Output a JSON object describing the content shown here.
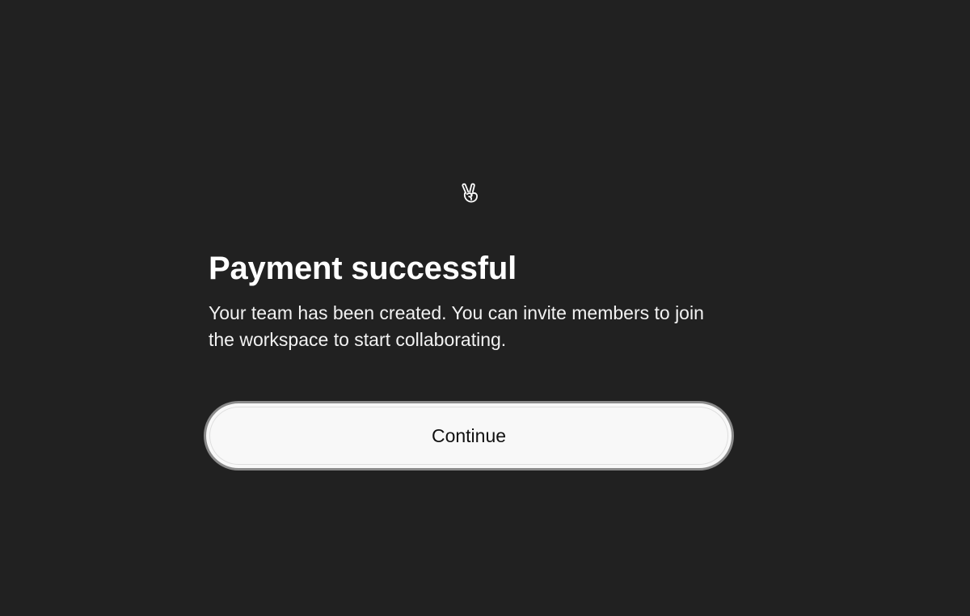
{
  "icon": {
    "name": "victory-hand-icon"
  },
  "dialog": {
    "title": "Payment successful",
    "message": "Your team has been created. You can invite members to join the workspace to start collaborating.",
    "continue_label": "Continue"
  },
  "colors": {
    "background": "#212121",
    "button_background": "#f8f8f8",
    "button_border": "#8a8a8a",
    "text_primary": "#ffffff",
    "button_text": "#111111"
  }
}
